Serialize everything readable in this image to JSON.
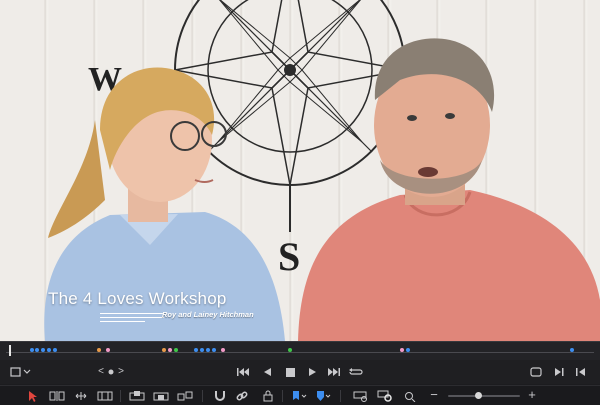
{
  "viewer": {
    "title": "The 4 Loves Workshop",
    "subtitle": "Roy and Lainey Hitchman",
    "wall_letters": [
      "W",
      "S"
    ]
  },
  "timeline": {
    "playhead_position": 0.0,
    "markers": [
      {
        "pos": 0.04,
        "color": "#3d8ef0"
      },
      {
        "pos": 0.05,
        "color": "#3d8ef0"
      },
      {
        "pos": 0.06,
        "color": "#3d8ef0"
      },
      {
        "pos": 0.07,
        "color": "#3d8ef0"
      },
      {
        "pos": 0.08,
        "color": "#3d8ef0"
      },
      {
        "pos": 0.155,
        "color": "#e89a4a"
      },
      {
        "pos": 0.17,
        "color": "#f29ac7"
      },
      {
        "pos": 0.265,
        "color": "#e89a4a"
      },
      {
        "pos": 0.275,
        "color": "#f29ac7"
      },
      {
        "pos": 0.285,
        "color": "#3fc74a"
      },
      {
        "pos": 0.32,
        "color": "#3d8ef0"
      },
      {
        "pos": 0.33,
        "color": "#3d8ef0"
      },
      {
        "pos": 0.34,
        "color": "#3d8ef0"
      },
      {
        "pos": 0.35,
        "color": "#3d8ef0"
      },
      {
        "pos": 0.365,
        "color": "#f29ac7"
      },
      {
        "pos": 0.48,
        "color": "#3fc74a"
      },
      {
        "pos": 0.67,
        "color": "#f29ac7"
      },
      {
        "pos": 0.68,
        "color": "#3d8ef0"
      },
      {
        "pos": 0.96,
        "color": "#3d8ef0"
      }
    ]
  },
  "transport": {
    "transform_icon": "transform-icon",
    "nav_prev": "<",
    "nav_next": ">",
    "buttons": [
      "skip-to-start-icon",
      "step-back-icon",
      "stop-icon",
      "play-icon",
      "skip-to-end-icon",
      "loop-icon"
    ],
    "right_buttons": [
      "fullscreen-icon",
      "previous-frame-icon",
      "next-frame-icon"
    ]
  },
  "toolbar": {
    "tools": [
      "selection-arrow-icon",
      "trim-icon",
      "dynamic-trim-icon",
      "blade-icon",
      "insert-icon",
      "overwrite-icon",
      "replace-icon",
      "snapping-icon",
      "linked-selection-icon",
      "position-lock-icon",
      "flag-icon",
      "marker-icon",
      "zoom-full-icon",
      "zoom-detail-icon",
      "zoom-custom-icon"
    ],
    "zoom_minus": "−",
    "zoom_plus": "+",
    "zoom_level": 0.42
  },
  "colors": {
    "panel_bg": "#1f1f22",
    "accent_blue": "#3d8ef0",
    "selection_red": "#e0463e",
    "shirt_coral": "#e0867a",
    "shirt_blue": "#a9c2e2"
  }
}
